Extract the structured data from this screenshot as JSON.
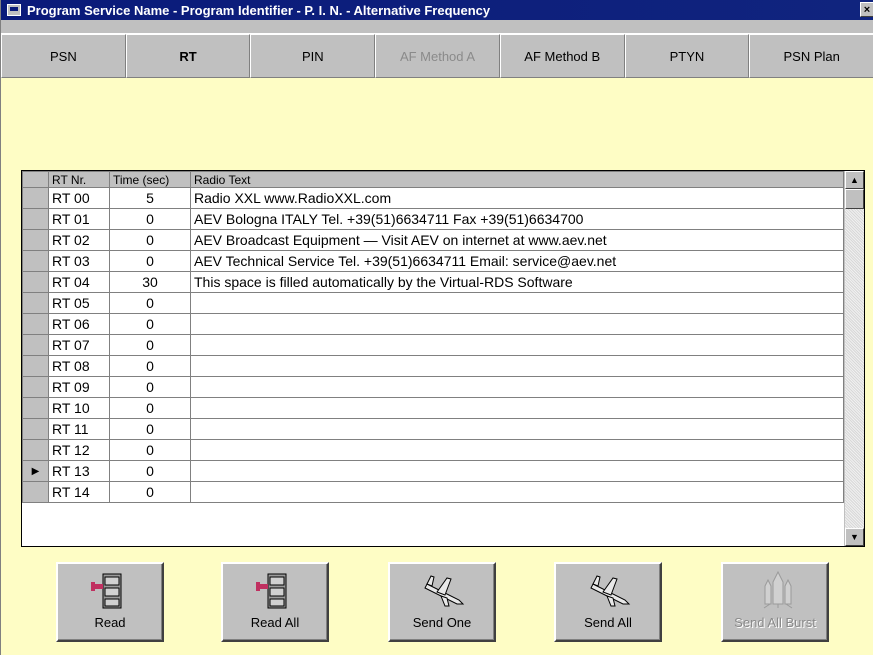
{
  "window": {
    "title": "Program Service Name - Program Identifier - P. I. N. - Alternative Frequency",
    "close_glyph": "×"
  },
  "tabs": [
    {
      "label": "PSN",
      "state": "normal"
    },
    {
      "label": "RT",
      "state": "active"
    },
    {
      "label": "PIN",
      "state": "normal"
    },
    {
      "label": "AF Method A",
      "state": "disabled"
    },
    {
      "label": "AF Method B",
      "state": "normal"
    },
    {
      "label": "PTYN",
      "state": "normal"
    },
    {
      "label": "PSN Plan",
      "state": "normal"
    }
  ],
  "grid": {
    "headers": {
      "nr": "RT Nr.",
      "time": "Time (sec)",
      "text": "Radio Text"
    },
    "current_row_marker": "▶",
    "rows": [
      {
        "nr": "RT 00",
        "time": "5",
        "text": "Radio XXL  www.RadioXXL.com"
      },
      {
        "nr": "RT 01",
        "time": "0",
        "text": "AEV Bologna ITALY Tel. +39(51)6634711   Fax +39(51)6634700"
      },
      {
        "nr": "RT 02",
        "time": "0",
        "text": "AEV Broadcast Equipment — Visit AEV on internet at www.aev.net"
      },
      {
        "nr": "RT 03",
        "time": "0",
        "text": "AEV Technical Service Tel. +39(51)6634711 Email: service@aev.net"
      },
      {
        "nr": "RT 04",
        "time": "30",
        "text": "This space is filled automatically by the Virtual-RDS Software"
      },
      {
        "nr": "RT 05",
        "time": "0",
        "text": ""
      },
      {
        "nr": "RT 06",
        "time": "0",
        "text": ""
      },
      {
        "nr": "RT 07",
        "time": "0",
        "text": ""
      },
      {
        "nr": "RT 08",
        "time": "0",
        "text": ""
      },
      {
        "nr": "RT 09",
        "time": "0",
        "text": ""
      },
      {
        "nr": "RT 10",
        "time": "0",
        "text": ""
      },
      {
        "nr": "RT 11",
        "time": "0",
        "text": ""
      },
      {
        "nr": "RT 12",
        "time": "0",
        "text": ""
      },
      {
        "nr": "RT 13",
        "time": "0",
        "text": "",
        "current": true
      },
      {
        "nr": "RT 14",
        "time": "0",
        "text": ""
      }
    ],
    "scroll_up_glyph": "▲",
    "scroll_down_glyph": "▼"
  },
  "buttons": {
    "read": {
      "label": "Read",
      "icon": "file-cabinet-icon"
    },
    "read_all": {
      "label": "Read All",
      "icon": "file-cabinet-icon"
    },
    "send_one": {
      "label": "Send One",
      "icon": "airplane-icon"
    },
    "send_all": {
      "label": "Send All",
      "icon": "airplane-icon"
    },
    "send_all_burst": {
      "label": "Send All Burst",
      "icon": "space-shuttle-icon",
      "disabled": true
    }
  },
  "colors": {
    "panel": "#fefdc5",
    "face": "#c0c0c0",
    "title": "#0a1a7a",
    "disabled_text": "#8a8a8a"
  }
}
